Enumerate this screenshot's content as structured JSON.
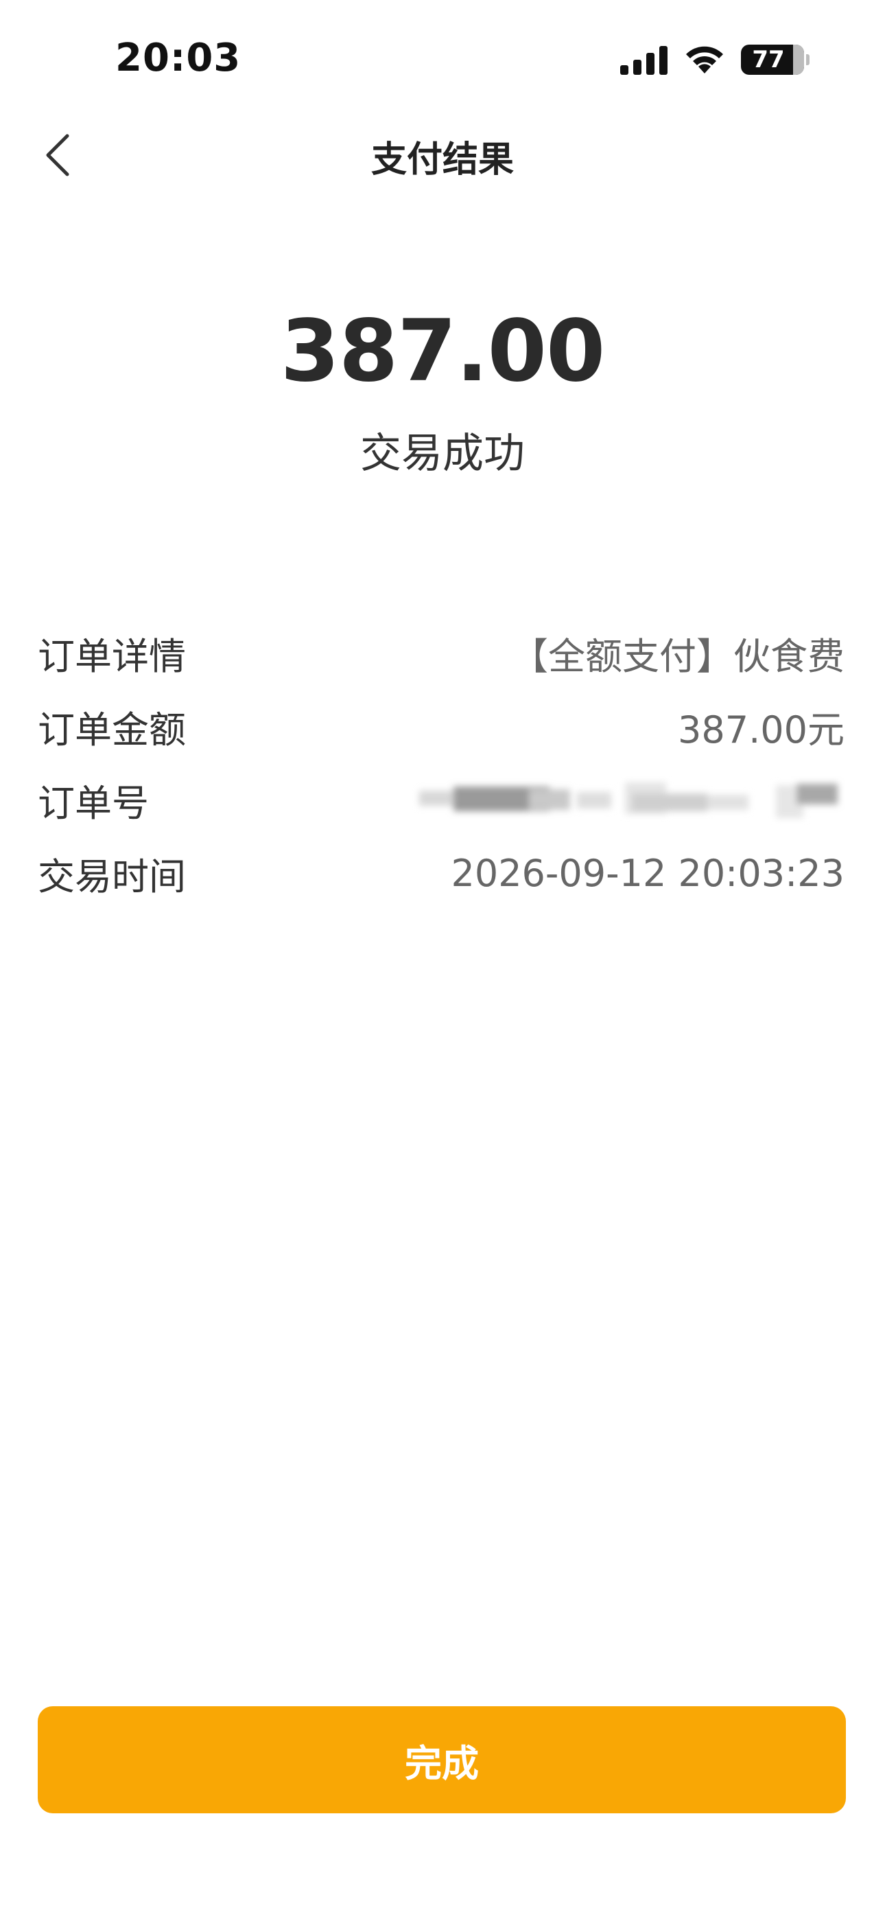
{
  "status_bar": {
    "time": "20:03",
    "battery": "77",
    "icons": [
      "signal-icon",
      "wifi-icon",
      "battery-icon"
    ]
  },
  "nav": {
    "title": "支付结果",
    "back_icon": "chevron-left-icon"
  },
  "payment": {
    "amount": "387.00",
    "status": "交易成功"
  },
  "details": {
    "order_detail_label": "订单详情",
    "order_detail_value": "【全额支付】伙食费",
    "order_amount_label": "订单金额",
    "order_amount_value": "387.00元",
    "order_no_label": "订单号",
    "trade_time_label": "交易时间",
    "trade_time_value": "2026-09-12 20:03:23"
  },
  "actions": {
    "done_label": "完成"
  },
  "colors": {
    "accent": "#f9a705",
    "text_primary": "#333333",
    "text_secondary": "#666666"
  }
}
